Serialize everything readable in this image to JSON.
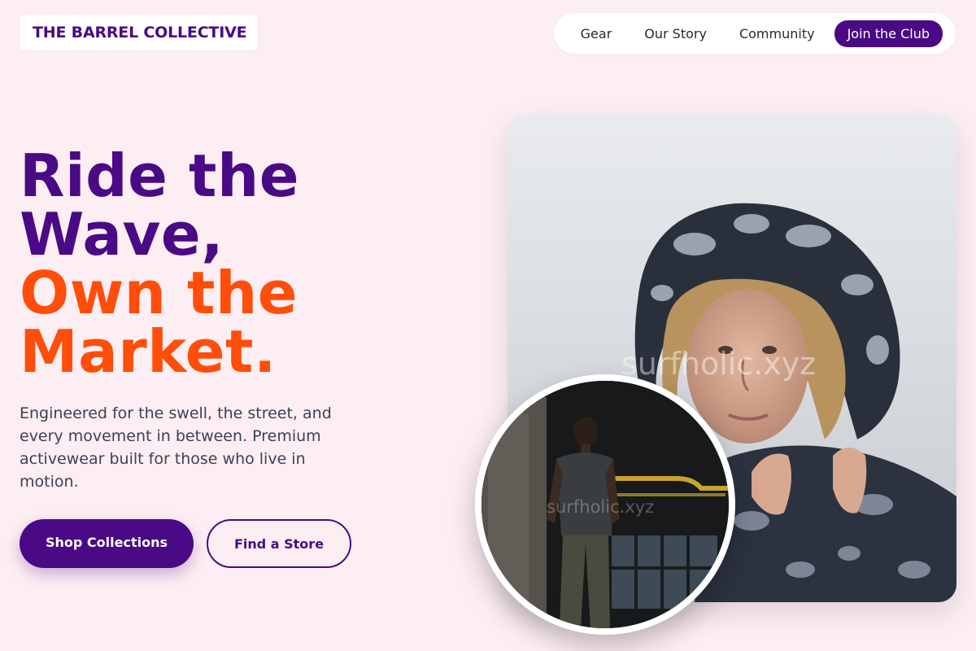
{
  "header": {
    "logo": "THE BARREL COLLECTIVE",
    "nav": [
      "Gear",
      "Our Story",
      "Community"
    ],
    "cta": "Join the Club"
  },
  "hero": {
    "headline_line1": "Ride the",
    "headline_line2": "Wave,",
    "headline_line3": "Own the",
    "headline_line4": "Market.",
    "description": "Engineered for the swell, the street, and every movement in between. Premium activewear built for those who live in motion.",
    "primary_button": "Shop Collections",
    "secondary_button": "Find a Store"
  },
  "images": {
    "main_watermark": "surfholic.xyz",
    "circle_watermark": "surfholic.xyz"
  },
  "colors": {
    "background": "#fdeef3",
    "brand_purple": "#4a0a86",
    "accent_orange": "#ff4d0a"
  }
}
